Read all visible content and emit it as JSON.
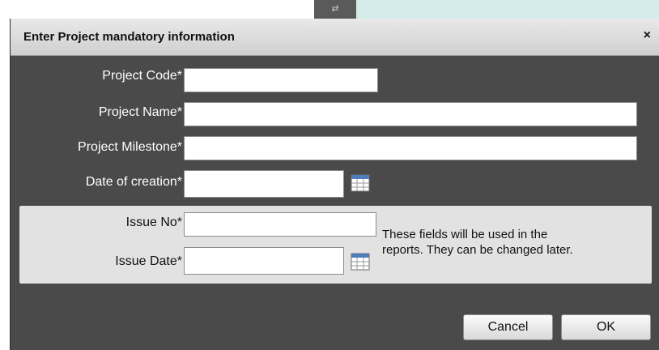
{
  "background": {
    "tab_glyph": "⇄"
  },
  "dialog": {
    "title": "Enter Project mandatory information",
    "close_label": "×",
    "fields": {
      "project_code": {
        "label": "Project Code*",
        "value": ""
      },
      "project_name": {
        "label": "Project Name*",
        "value": ""
      },
      "project_milestone": {
        "label": "Project Milestone*",
        "value": ""
      },
      "date_of_creation": {
        "label": "Date of creation*",
        "value": ""
      },
      "issue_no": {
        "label": "Issue No*",
        "value": ""
      },
      "issue_date": {
        "label": "Issue Date*",
        "value": ""
      }
    },
    "note_line1": "These fields will be used in the",
    "note_line2": "reports. They can be changed later.",
    "buttons": {
      "cancel": "Cancel",
      "ok": "OK"
    },
    "icons": [
      "calendar-icon",
      "close-icon"
    ],
    "colors": {
      "dialog_bg": "#4a4a4a",
      "panel_bg": "#e2e2e2",
      "titlebar_bg": "#dcdcdc"
    }
  }
}
